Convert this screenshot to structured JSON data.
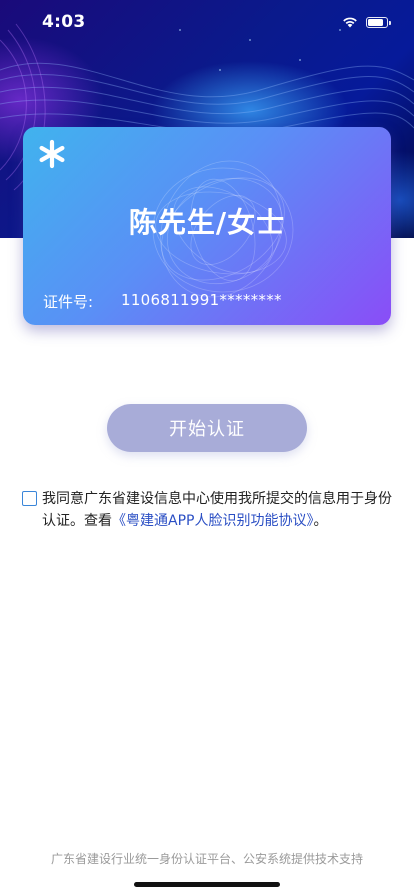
{
  "status_bar": {
    "time": "4:03",
    "battery_level": 0.85
  },
  "card": {
    "name": "陈先生/女士",
    "id_label": "证件号:",
    "id_value": "1106811991********"
  },
  "actions": {
    "start_label": "开始认证"
  },
  "agreement": {
    "text_before": "我同意广东省建设信息中心使用我所提交的信息用于身份认证。查看",
    "link_text": "《粤建通APP人脸识别功能协议》",
    "text_after": "。",
    "checked": false
  },
  "footer": {
    "note": "广东省建设行业统一身份认证平台、公安系统提供技术支持"
  },
  "colors": {
    "card_gradient_start": "#40b3ee",
    "card_gradient_end": "#8a4df7",
    "button_bg": "#a8acd8",
    "link": "#2b4fc4",
    "checkbox_border": "#3a86d9"
  }
}
